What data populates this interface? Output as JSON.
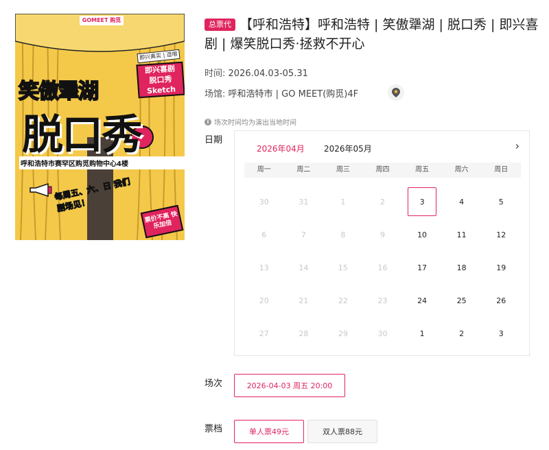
{
  "poster": {
    "logo": "GOMEET 购觅",
    "tags": "即兴真实 | 逗哏无",
    "title_line1": "笑傲犟湖",
    "sub_tags": [
      "即兴喜剧",
      "脱口秀",
      "Sketch"
    ],
    "title_line2": "脱口秀",
    "address": "呼和浩特市赛罕区购觅购物中心4楼",
    "note": "每周五、六、日 我们剧场见！",
    "badge": "票价不高 快乐加倍"
  },
  "header": {
    "agent_badge": "总票代",
    "title": "【呼和浩特】呼和浩特 | 笑傲犟湖 | 脱口秀 | 即兴喜剧 | 爆笑脱口秀·拯救不开心"
  },
  "info": {
    "time_label": "时间:",
    "time_value": "2026.04.03-05.31",
    "venue_label": "场馆:",
    "venue_value": "呼和浩特市 | GO MEET(购觅)4F",
    "tz_note": "场次时间均为演出当地时间"
  },
  "date_section": {
    "label": "日期",
    "months": [
      "2026年04月",
      "2026年05月"
    ],
    "active_month_index": 0,
    "next_icon": "chevron-right-icon",
    "weekdays": [
      "周一",
      "周二",
      "周三",
      "周四",
      "周五",
      "周六",
      "周日"
    ],
    "days": [
      {
        "d": "30",
        "enabled": false
      },
      {
        "d": "31",
        "enabled": false
      },
      {
        "d": "1",
        "enabled": false
      },
      {
        "d": "2",
        "enabled": false
      },
      {
        "d": "3",
        "enabled": true,
        "selected": true
      },
      {
        "d": "4",
        "enabled": true
      },
      {
        "d": "5",
        "enabled": true
      },
      {
        "d": "6",
        "enabled": false
      },
      {
        "d": "7",
        "enabled": false
      },
      {
        "d": "8",
        "enabled": false
      },
      {
        "d": "9",
        "enabled": false
      },
      {
        "d": "10",
        "enabled": true
      },
      {
        "d": "11",
        "enabled": true
      },
      {
        "d": "12",
        "enabled": true
      },
      {
        "d": "13",
        "enabled": false
      },
      {
        "d": "14",
        "enabled": false
      },
      {
        "d": "15",
        "enabled": false
      },
      {
        "d": "16",
        "enabled": false
      },
      {
        "d": "17",
        "enabled": true
      },
      {
        "d": "18",
        "enabled": true
      },
      {
        "d": "19",
        "enabled": true
      },
      {
        "d": "20",
        "enabled": false
      },
      {
        "d": "21",
        "enabled": false
      },
      {
        "d": "22",
        "enabled": false
      },
      {
        "d": "23",
        "enabled": false
      },
      {
        "d": "24",
        "enabled": true
      },
      {
        "d": "25",
        "enabled": true
      },
      {
        "d": "26",
        "enabled": true
      },
      {
        "d": "27",
        "enabled": false
      },
      {
        "d": "28",
        "enabled": false
      },
      {
        "d": "29",
        "enabled": false
      },
      {
        "d": "30",
        "enabled": false
      },
      {
        "d": "1",
        "enabled": true
      },
      {
        "d": "2",
        "enabled": true
      },
      {
        "d": "3",
        "enabled": true
      }
    ]
  },
  "session_section": {
    "label": "场次",
    "options": [
      "2026-04-03 周五 20:00"
    ]
  },
  "ticket_section": {
    "label": "票档",
    "options": [
      "单人票49元",
      "双人票88元"
    ]
  },
  "colors": {
    "accent": "#e0245e",
    "poster_bg": "#f4c94a"
  }
}
